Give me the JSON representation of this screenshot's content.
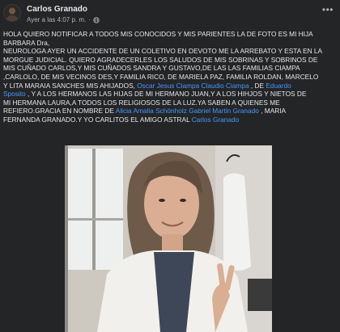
{
  "post": {
    "author": "Carlos Granado",
    "timestamp": "Ayer a las 4:07 p. m.",
    "separator": "·",
    "more_label": "•••",
    "body_lines": [
      [
        {
          "t": "HOLA QUIERO NOTIFICAR A TODOS MIS CONOCIDOS Y MIS PARIENTES LA DE FOTO ES MI HIJA"
        }
      ],
      [
        {
          "t": "BARBARA Dra,"
        }
      ],
      [
        {
          "t": "NEUROLOGA AYER UN ACCIDENTE DE UN COLETIVO EN DEVOTO ME LA ARREBATO Y ESTA EN LA"
        }
      ],
      [
        {
          "t": "MORGUE JUDICIAL. QUIERO AGRADECERLES LOS SALUDOS DE MIS SOBRINAS Y SOBRINOS DE"
        }
      ],
      [
        {
          "t": "MIS CUÑADO CARLOS,Y MIS CUÑADOS SANDRA Y GUSTAVO,DE LAS LAS FAMILIAS  CIAMPA"
        }
      ],
      [
        {
          "t": ",CARLOLO, DE MIS VECINOS DES,Y FAMILIA RICO, DE MARIELA PAZ,   FAMILIA ROLDAN, MARCELO"
        }
      ],
      [
        {
          "t": "Y LITA MARAIA SANCHES MIS AHIJADOS, "
        },
        {
          "t": "Oscar Jesus Ciampa",
          "m": true
        },
        {
          "t": "  "
        },
        {
          "t": "Claudio Ciampa",
          "m": true
        },
        {
          "t": " ,   DE "
        },
        {
          "t": "Eduardo",
          "m": true
        }
      ],
      [
        {
          "t": "Sposito",
          "m": true
        },
        {
          "t": " ,    Y A LOS  HERMANOS LAS HIJAS DE MI HERMANO JUAN,Y A LOS HIHJOS Y NIETOS DE"
        }
      ],
      [
        {
          "t": "MI HERMANA LAURA,A TODOS LOS RELIGIOSOS  DE LA LUZ.YA SABEN A QUIENES ME"
        }
      ],
      [
        {
          "t": "REFIERO.GRACIA EN NOMBRE DE "
        },
        {
          "t": "Alicia Amalia Schönholz",
          "m": true
        },
        {
          "t": "    "
        },
        {
          "t": "Gabriel Martin Granado",
          "m": true
        },
        {
          "t": " , MARIA"
        }
      ],
      [
        {
          "t": "FERNANDA GRANADO.Y YO CARLITOS EL AMIGO ASTRAL "
        },
        {
          "t": "Carlos Granado",
          "m": true
        }
      ]
    ]
  },
  "icons": {
    "avatar": "user-avatar",
    "privacy": "globe-icon",
    "more": "more-options-icon"
  },
  "colors": {
    "background": "#242526",
    "text": "#e4e6eb",
    "secondary": "#b0b3b8",
    "mention": "#4599ff"
  },
  "photo": {
    "description_visible": false
  }
}
